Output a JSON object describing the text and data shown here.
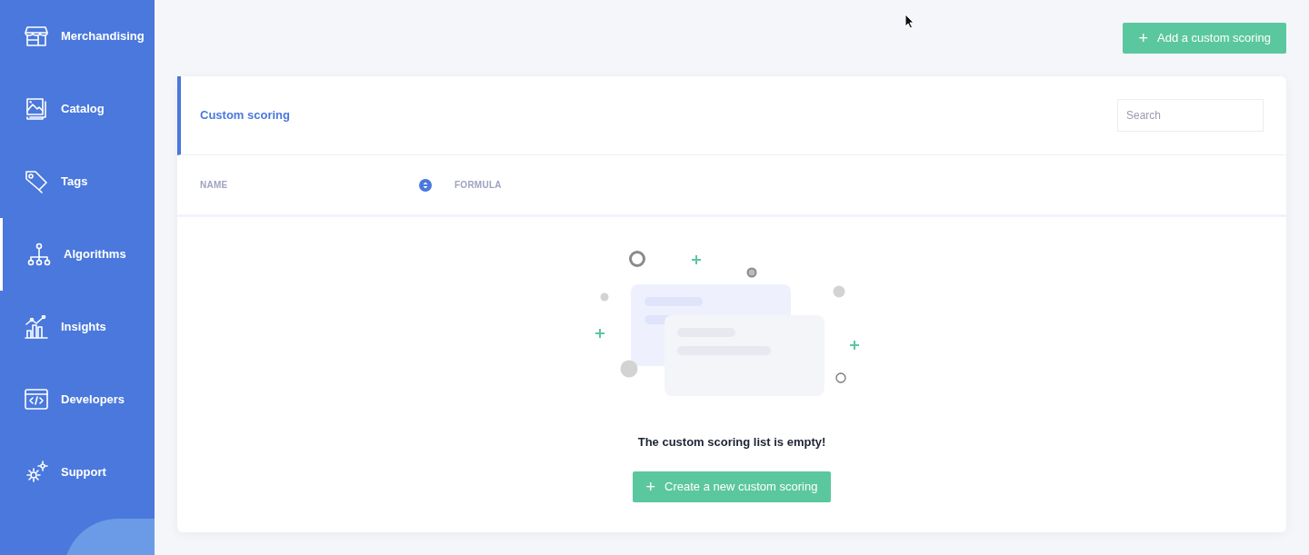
{
  "sidebar": {
    "items": [
      {
        "label": "Merchandising",
        "selected": false
      },
      {
        "label": "Catalog",
        "selected": false
      },
      {
        "label": "Tags",
        "selected": false
      },
      {
        "label": "Algorithms",
        "selected": true
      },
      {
        "label": "Insights",
        "selected": false
      },
      {
        "label": "Developers",
        "selected": false
      },
      {
        "label": "Support",
        "selected": false
      }
    ]
  },
  "add_button": {
    "label": "Add a custom scoring",
    "icon": "+"
  },
  "panel": {
    "title": "Custom scoring",
    "search": {
      "placeholder": "Search"
    },
    "table": {
      "columns": [
        "NAME",
        "FORMULA"
      ]
    },
    "empty_state": {
      "message": "The custom scoring list is empty!",
      "button": {
        "label": "Create a new custom scoring",
        "icon": "+"
      }
    }
  }
}
